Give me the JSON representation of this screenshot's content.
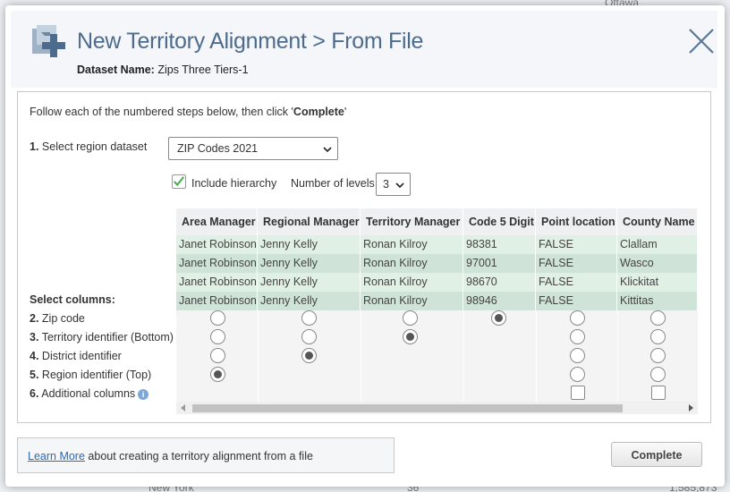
{
  "background": {
    "top_right": "Ottawa",
    "bottom_left": "New York",
    "bottom_mid": "36",
    "bottom_right": "1,585,873"
  },
  "dialog": {
    "title": "New Territory Alignment > From File",
    "dataset_label": "Dataset Name:",
    "dataset_name": "Zips Three Tiers-1",
    "instruction_prefix": "Follow each of the numbered steps below, then click '",
    "instruction_bold": "Complete",
    "instruction_suffix": "'"
  },
  "step1": {
    "num": "1.",
    "label": "Select region dataset",
    "value": "ZIP Codes 2021"
  },
  "hierarchy": {
    "include_label": "Include hierarchy",
    "include_checked": true,
    "levels_label": "Number of levels",
    "levels_value": "3"
  },
  "select_columns_label": "Select columns:",
  "steps": [
    {
      "num": "2.",
      "label": "Zip code"
    },
    {
      "num": "3.",
      "label": "Territory identifier (Bottom)"
    },
    {
      "num": "4.",
      "label": "District identifier"
    },
    {
      "num": "5.",
      "label": "Region identifier (Top)"
    },
    {
      "num": "6.",
      "label": "Additional columns"
    }
  ],
  "table": {
    "columns": [
      "Area Manager",
      "Regional Manager",
      "Territory Manager",
      "Code 5 Digit",
      "Point location",
      "County Name"
    ],
    "rows": [
      [
        "Janet Robinson",
        "Jenny Kelly",
        "Ronan Kilroy",
        "98381",
        "FALSE",
        "Clallam"
      ],
      [
        "Janet Robinson",
        "Jenny Kelly",
        "Ronan Kilroy",
        "97001",
        "FALSE",
        "Wasco"
      ],
      [
        "Janet Robinson",
        "Jenny Kelly",
        "Ronan Kilroy",
        "98670",
        "FALSE",
        "Klickitat"
      ],
      [
        "Janet Robinson",
        "Jenny Kelly",
        "Ronan Kilroy",
        "98946",
        "FALSE",
        "Kittitas"
      ]
    ],
    "selections": {
      "zip_code": "Code 5 Digit",
      "territory": "Territory Manager",
      "district": "Regional Manager",
      "region": "Area Manager"
    }
  },
  "footer": {
    "link": "Learn More",
    "text": " about creating a territory alignment from a file",
    "complete_button": "Complete"
  }
}
